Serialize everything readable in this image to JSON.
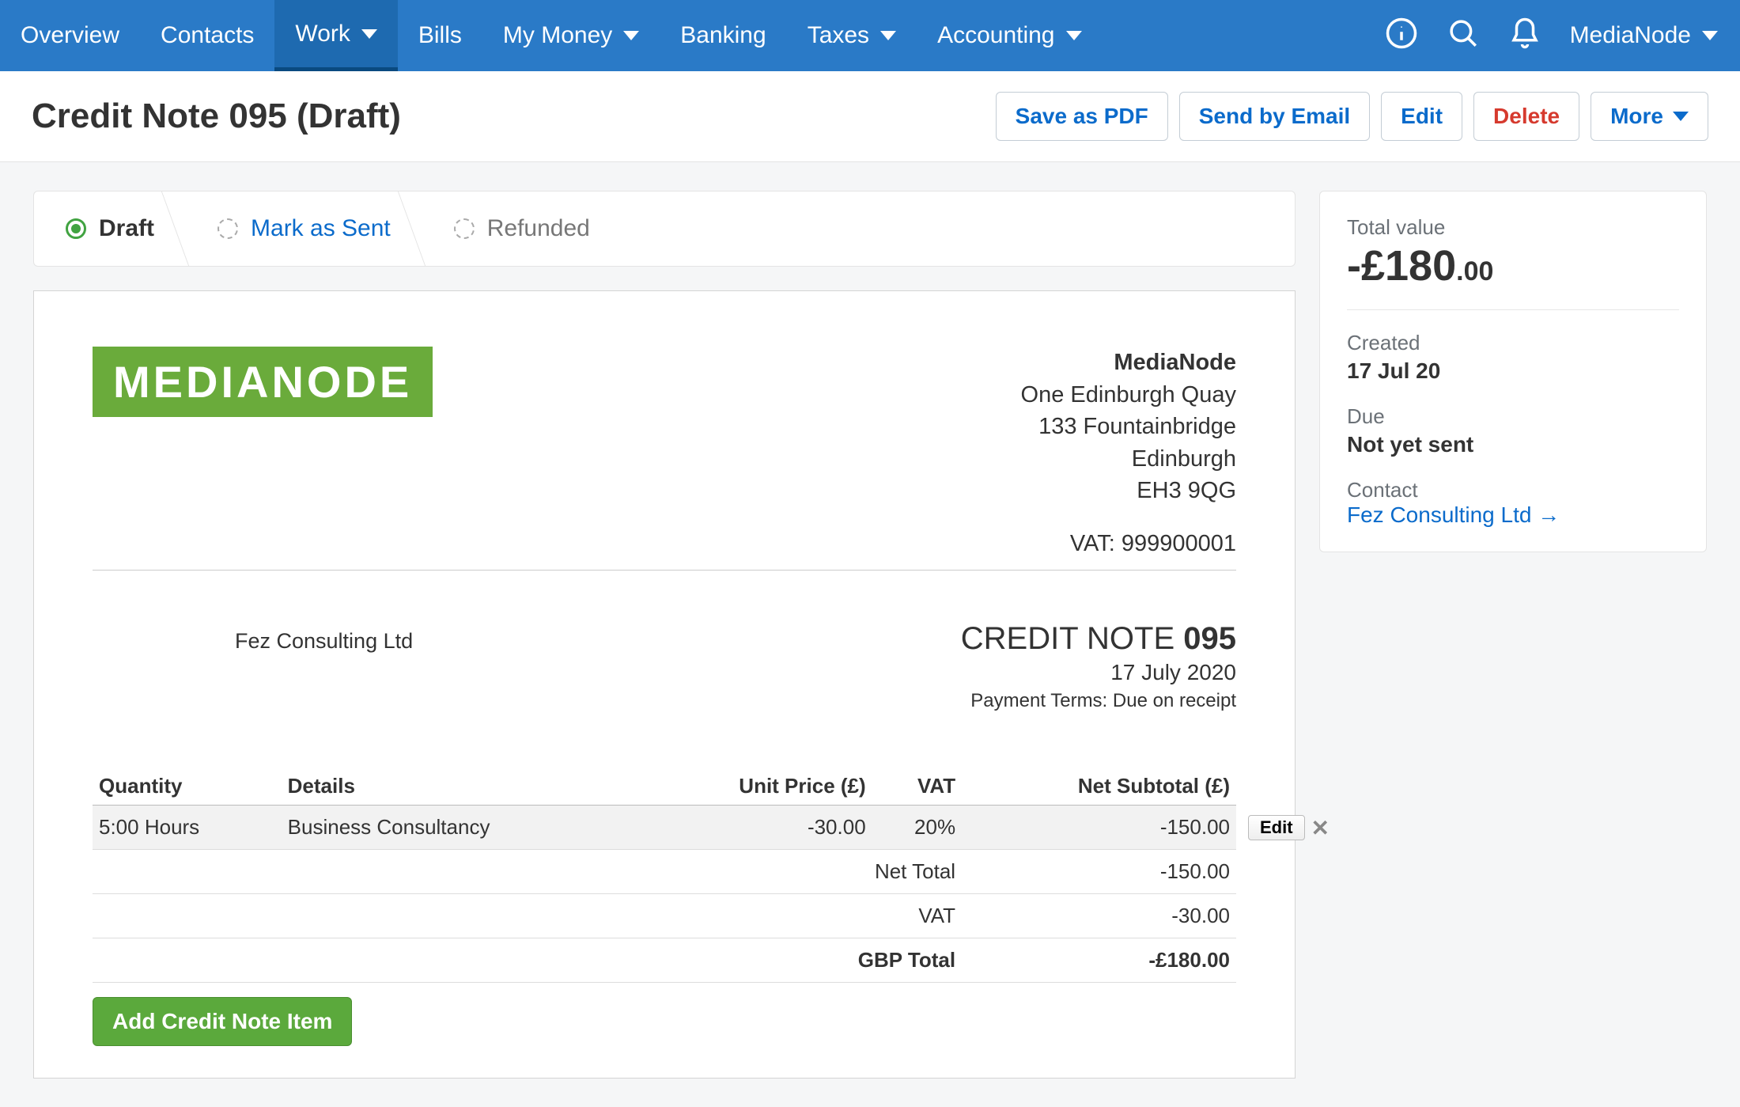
{
  "nav": {
    "items": [
      {
        "label": "Overview",
        "dropdown": false
      },
      {
        "label": "Contacts",
        "dropdown": false
      },
      {
        "label": "Work",
        "dropdown": true,
        "active": true
      },
      {
        "label": "Bills",
        "dropdown": false
      },
      {
        "label": "My Money",
        "dropdown": true
      },
      {
        "label": "Banking",
        "dropdown": false
      },
      {
        "label": "Taxes",
        "dropdown": true
      },
      {
        "label": "Accounting",
        "dropdown": true
      }
    ],
    "org": "MediaNode"
  },
  "page": {
    "title": "Credit Note 095 (Draft)",
    "actions": {
      "save_pdf": "Save as PDF",
      "send_email": "Send by Email",
      "edit": "Edit",
      "delete": "Delete",
      "more": "More"
    }
  },
  "steps": {
    "draft": "Draft",
    "mark_sent": "Mark as Sent",
    "refunded": "Refunded"
  },
  "doc": {
    "logo_text": "MEDIANODE",
    "company": {
      "name": "MediaNode",
      "line1": "One Edinburgh Quay",
      "line2": "133 Fountainbridge",
      "city": "Edinburgh",
      "postcode": "EH3 9QG",
      "vat": "VAT: 999900001"
    },
    "bill_to": "Fez Consulting Ltd",
    "kind": "CREDIT NOTE",
    "number": "095",
    "date": "17 July 2020",
    "terms": "Payment Terms: Due on receipt",
    "line_items": {
      "cols": [
        "Quantity",
        "Details",
        "Unit Price (£)",
        "VAT",
        "Net Subtotal (£)"
      ],
      "rows": [
        {
          "qty": "5:00 Hours",
          "details": "Business Consultancy",
          "unit": "-30.00",
          "vat": "20%",
          "net": "-150.00"
        }
      ],
      "row_edit": "Edit"
    },
    "totals": [
      {
        "label": "Net Total",
        "value": "-150.00"
      },
      {
        "label": "VAT",
        "value": "-30.00"
      },
      {
        "label": "GBP Total",
        "value": "-£180.00"
      }
    ],
    "add_button": "Add Credit Note Item"
  },
  "sidebar": {
    "total_label": "Total value",
    "total_main": "-£180",
    "total_dec": ".00",
    "created_label": "Created",
    "created": "17 Jul 20",
    "due_label": "Due",
    "due": "Not yet sent",
    "contact_label": "Contact",
    "contact": "Fez Consulting Ltd →"
  }
}
